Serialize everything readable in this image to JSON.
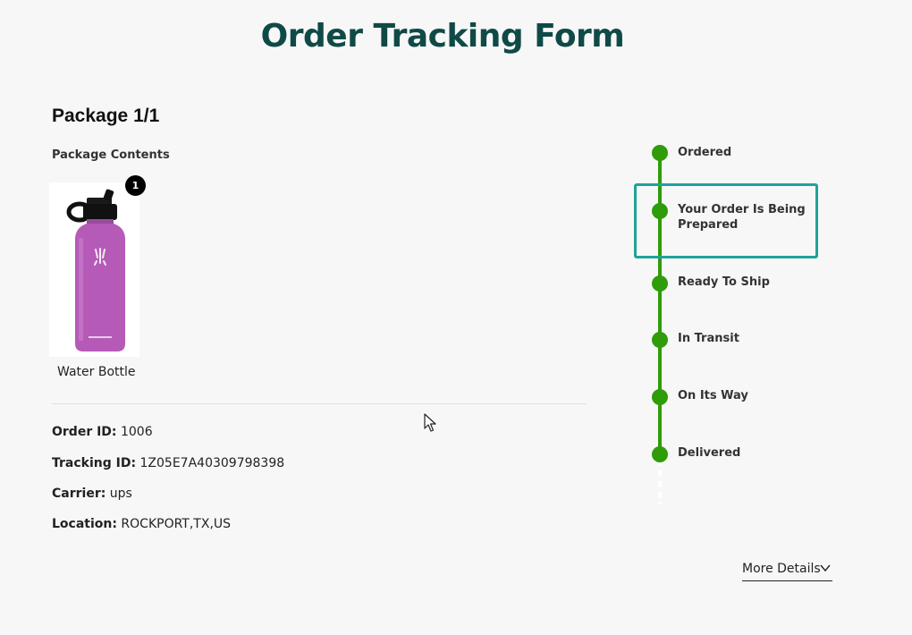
{
  "page": {
    "title": "Order Tracking Form"
  },
  "package": {
    "title": "Package 1/1",
    "contents_label": "Package Contents",
    "items": [
      {
        "name": "Water Bottle",
        "quantity": "1",
        "image_icon": "water-bottle-image",
        "bottle_color": "#b65ab8"
      }
    ]
  },
  "details": {
    "order_id_label": "Order ID:",
    "order_id": "1006",
    "tracking_id_label": "Tracking ID:",
    "tracking_id": "1Z05E7A40309798398",
    "carrier_label": "Carrier:",
    "carrier": "ups",
    "location_label": "Location:",
    "location": "ROCKPORT,TX,US"
  },
  "timeline": {
    "steps": [
      {
        "label": "Ordered",
        "done": true
      },
      {
        "label": "Your Order Is Being Prepared",
        "done": true,
        "current": true
      },
      {
        "label": "Ready To Ship",
        "done": true
      },
      {
        "label": "In Transit",
        "done": true
      },
      {
        "label": "On Its Way",
        "done": true
      },
      {
        "label": "Delivered",
        "done": true
      }
    ],
    "complete_color": "#2f9c0a",
    "highlight_color": "#1fa29c"
  },
  "actions": {
    "more_details_label": "More Details",
    "more_details_icon": "chevron-down-icon"
  },
  "colors": {
    "title": "#0f4a47",
    "background": "#f7f7f7"
  }
}
